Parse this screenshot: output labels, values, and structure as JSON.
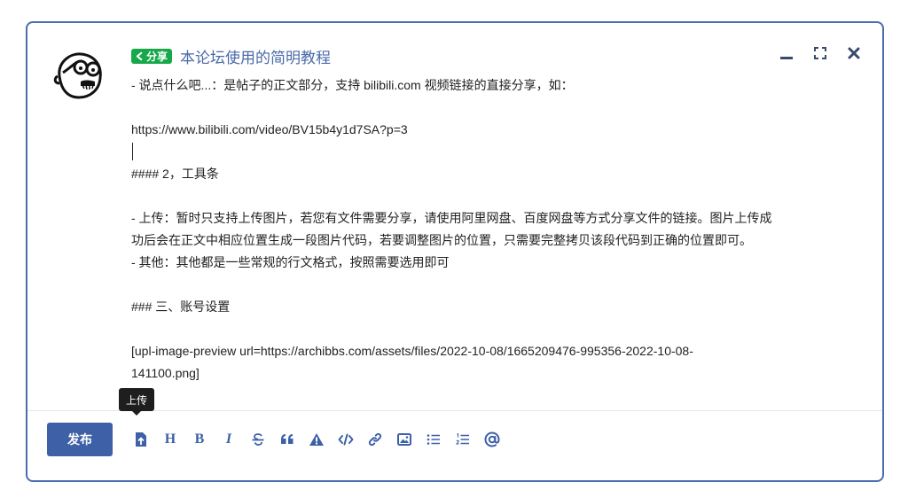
{
  "header": {
    "badge_label": "分享",
    "title": "本论坛使用的简明教程"
  },
  "editor": {
    "line_1": "- 说点什么吧...：是帖子的正文部分，支持 bilibili.com 视频链接的直接分享，如：",
    "line_2": "https://www.bilibili.com/video/BV15b4y1d7SA?p=3",
    "line_3": "#### 2，工具条",
    "line_4": "- 上传：暂时只支持上传图片，若您有文件需要分享，请使用阿里网盘、百度网盘等方式分享文件的链接。图片上传成",
    "line_5": "功后会在正文中相应位置生成一段图片代码，若要调整图片的位置，只需要完整拷贝该段代码到正确的位置即可。",
    "line_6": "- 其他：其他都是一些常规的行文格式，按照需要选用即可",
    "line_7": "### 三、账号设置",
    "line_8": "[upl-image-preview url=https://archibbs.com/assets/files/2022-10-08/1665209476-995356-2022-10-08-",
    "line_9": "141100.png]"
  },
  "tooltip": {
    "text": "上传"
  },
  "actions": {
    "publish_label": "发布"
  },
  "toolbar": {
    "heading_label": "H",
    "bold_label": "B",
    "italic_label": "I",
    "tools": [
      "upload-icon",
      "heading",
      "bold",
      "italic",
      "strikethrough-icon",
      "quote-icon",
      "spoiler-warning-icon",
      "code-icon",
      "link-icon",
      "image-icon",
      "bulleted-list-icon",
      "numbered-list-icon",
      "mention-icon"
    ]
  },
  "colors": {
    "accent": "#3e60a6",
    "badge": "#17a84a",
    "title": "#4a6aa8",
    "frame": "#4a6db0"
  }
}
